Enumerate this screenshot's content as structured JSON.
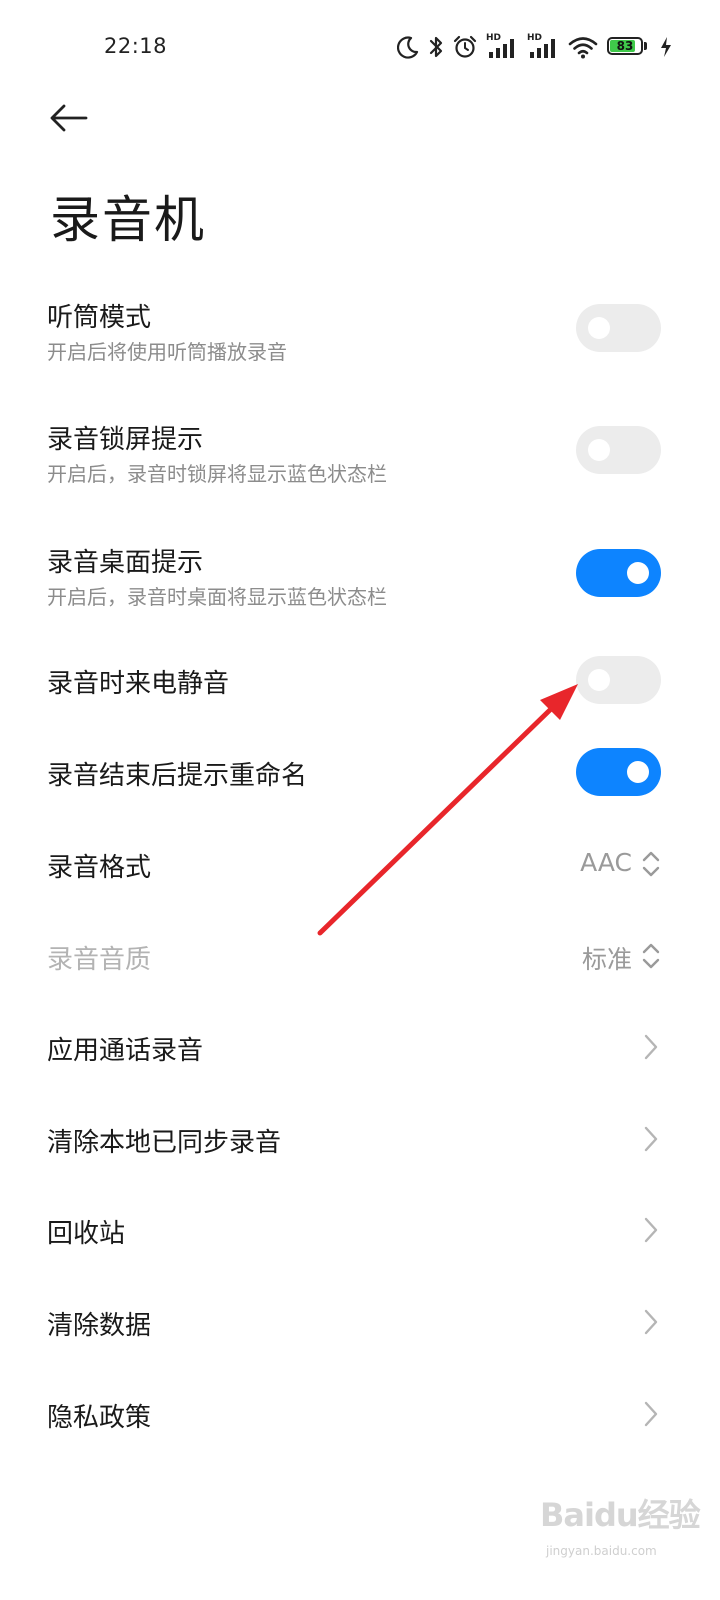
{
  "status_bar": {
    "time": "22:18",
    "battery_level": "83",
    "battery_fraction": 0.83,
    "icons": [
      "moon-icon",
      "bluetooth-icon",
      "alarm-icon",
      "hd-signal-icon",
      "hd-signal-icon",
      "wifi-icon",
      "battery-icon",
      "charging-icon"
    ],
    "signal_label_1": "HD",
    "signal_label_2": "HD"
  },
  "header": {
    "back_icon": "back-arrow-icon",
    "title": "录音机"
  },
  "settings": [
    {
      "id": "earpiece-mode",
      "title": "听筒模式",
      "subtitle": "开启后将使用听筒播放录音",
      "control": "toggle",
      "on": false
    },
    {
      "id": "lockscreen-hint",
      "title": "录音锁屏提示",
      "subtitle": "开启后，录音时锁屏将显示蓝色状态栏",
      "control": "toggle",
      "on": false
    },
    {
      "id": "desktop-hint",
      "title": "录音桌面提示",
      "subtitle": "开启后，录音时桌面将显示蓝色状态栏",
      "control": "toggle",
      "on": true
    },
    {
      "id": "mute-calls",
      "title": "录音时来电静音",
      "control": "toggle",
      "on": false
    },
    {
      "id": "rename-prompt",
      "title": "录音结束后提示重命名",
      "control": "toggle",
      "on": true
    },
    {
      "id": "format",
      "title": "录音格式",
      "control": "select",
      "value": "AAC"
    },
    {
      "id": "quality",
      "title": "录音音质",
      "control": "select",
      "value": "标准",
      "disabled": true
    },
    {
      "id": "call-recording",
      "title": "应用通话录音",
      "control": "link"
    },
    {
      "id": "clear-synced",
      "title": "清除本地已同步录音",
      "control": "link"
    },
    {
      "id": "recycle-bin",
      "title": "回收站",
      "control": "link"
    },
    {
      "id": "clear-data",
      "title": "清除数据",
      "control": "link"
    },
    {
      "id": "privacy-policy",
      "title": "隐私政策",
      "control": "link"
    }
  ],
  "colors": {
    "toggle_on": "#0d84ff",
    "toggle_off": "#ececec",
    "annotation_arrow": "#e8262b"
  },
  "watermark": {
    "logo": "Baidu经验",
    "url": "jingyan.baidu.com"
  }
}
